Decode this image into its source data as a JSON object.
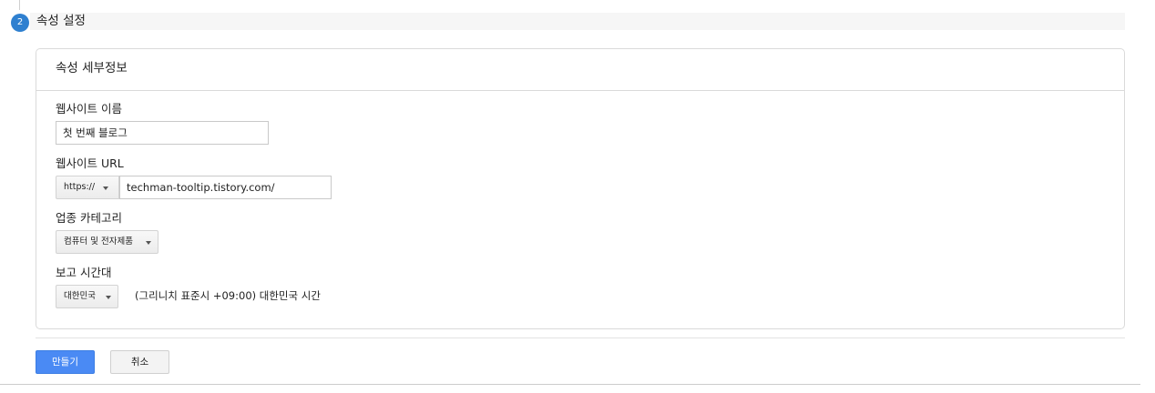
{
  "step": {
    "number": "2",
    "title": "속성 설정"
  },
  "card": {
    "title": "속성 세부정보"
  },
  "fields": {
    "website_name": {
      "label": "웹사이트 이름",
      "value": "첫 번째 블로그"
    },
    "website_url": {
      "label": "웹사이트 URL",
      "protocol": "https://",
      "value": "techman-tooltip.tistory.com/"
    },
    "industry": {
      "label": "업종 카테고리",
      "value": "컴퓨터 및 전자제품"
    },
    "timezone": {
      "label": "보고 시간대",
      "country": "대한민국",
      "description": "(그리니치 표준시 +09:00) 대한민국 시간"
    }
  },
  "actions": {
    "create_label": "만들기",
    "cancel_label": "취소"
  },
  "colors": {
    "accent": "#4a8af4",
    "step_badge": "#2f80d0"
  }
}
